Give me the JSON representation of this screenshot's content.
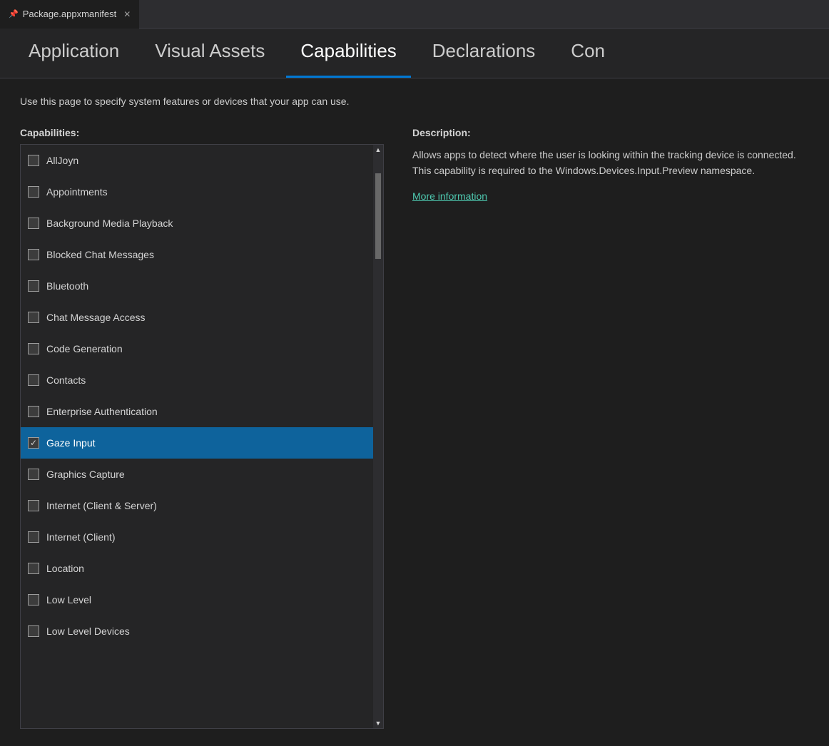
{
  "tab_bar": {
    "tab_label": "Package.appxmanifest",
    "pin_icon": "📌",
    "close_icon": "✕"
  },
  "nav_tabs": [
    {
      "id": "application",
      "label": "Application",
      "active": false
    },
    {
      "id": "visual-assets",
      "label": "Visual Assets",
      "active": false
    },
    {
      "id": "capabilities",
      "label": "Capabilities",
      "active": true
    },
    {
      "id": "declarations",
      "label": "Declarations",
      "active": false
    },
    {
      "id": "con",
      "label": "Con",
      "active": false
    }
  ],
  "page_description": "Use this page to specify system features or devices that your app can use.",
  "capabilities_section": {
    "label": "Capabilities:",
    "items": [
      {
        "id": "alljoyn",
        "label": "AllJoyn",
        "checked": false,
        "selected": false
      },
      {
        "id": "appointments",
        "label": "Appointments",
        "checked": false,
        "selected": false
      },
      {
        "id": "background-media-playback",
        "label": "Background Media Playback",
        "checked": false,
        "selected": false
      },
      {
        "id": "blocked-chat-messages",
        "label": "Blocked Chat Messages",
        "checked": false,
        "selected": false
      },
      {
        "id": "bluetooth",
        "label": "Bluetooth",
        "checked": false,
        "selected": false
      },
      {
        "id": "chat-message-access",
        "label": "Chat Message Access",
        "checked": false,
        "selected": false
      },
      {
        "id": "code-generation",
        "label": "Code Generation",
        "checked": false,
        "selected": false
      },
      {
        "id": "contacts",
        "label": "Contacts",
        "checked": false,
        "selected": false
      },
      {
        "id": "enterprise-authentication",
        "label": "Enterprise Authentication",
        "checked": false,
        "selected": false
      },
      {
        "id": "gaze-input",
        "label": "Gaze Input",
        "checked": true,
        "selected": true
      },
      {
        "id": "graphics-capture",
        "label": "Graphics Capture",
        "checked": false,
        "selected": false
      },
      {
        "id": "internet-client-server",
        "label": "Internet (Client & Server)",
        "checked": false,
        "selected": false
      },
      {
        "id": "internet-client",
        "label": "Internet (Client)",
        "checked": false,
        "selected": false
      },
      {
        "id": "location",
        "label": "Location",
        "checked": false,
        "selected": false
      },
      {
        "id": "low-level",
        "label": "Low Level",
        "checked": false,
        "selected": false
      },
      {
        "id": "low-level-devices",
        "label": "Low Level Devices",
        "checked": false,
        "selected": false
      }
    ]
  },
  "description_section": {
    "label": "Description:",
    "text": "Allows apps to detect where the user is looking within the tracking device is connected. This capability is required to the Windows.Devices.Input.Preview namespace.",
    "more_info_label": "More information"
  },
  "colors": {
    "active_tab_border": "#0078d4",
    "selected_item_bg": "#0e639c",
    "link_color": "#4ec9b0",
    "background": "#1e1e1e",
    "panel_bg": "#252526"
  }
}
